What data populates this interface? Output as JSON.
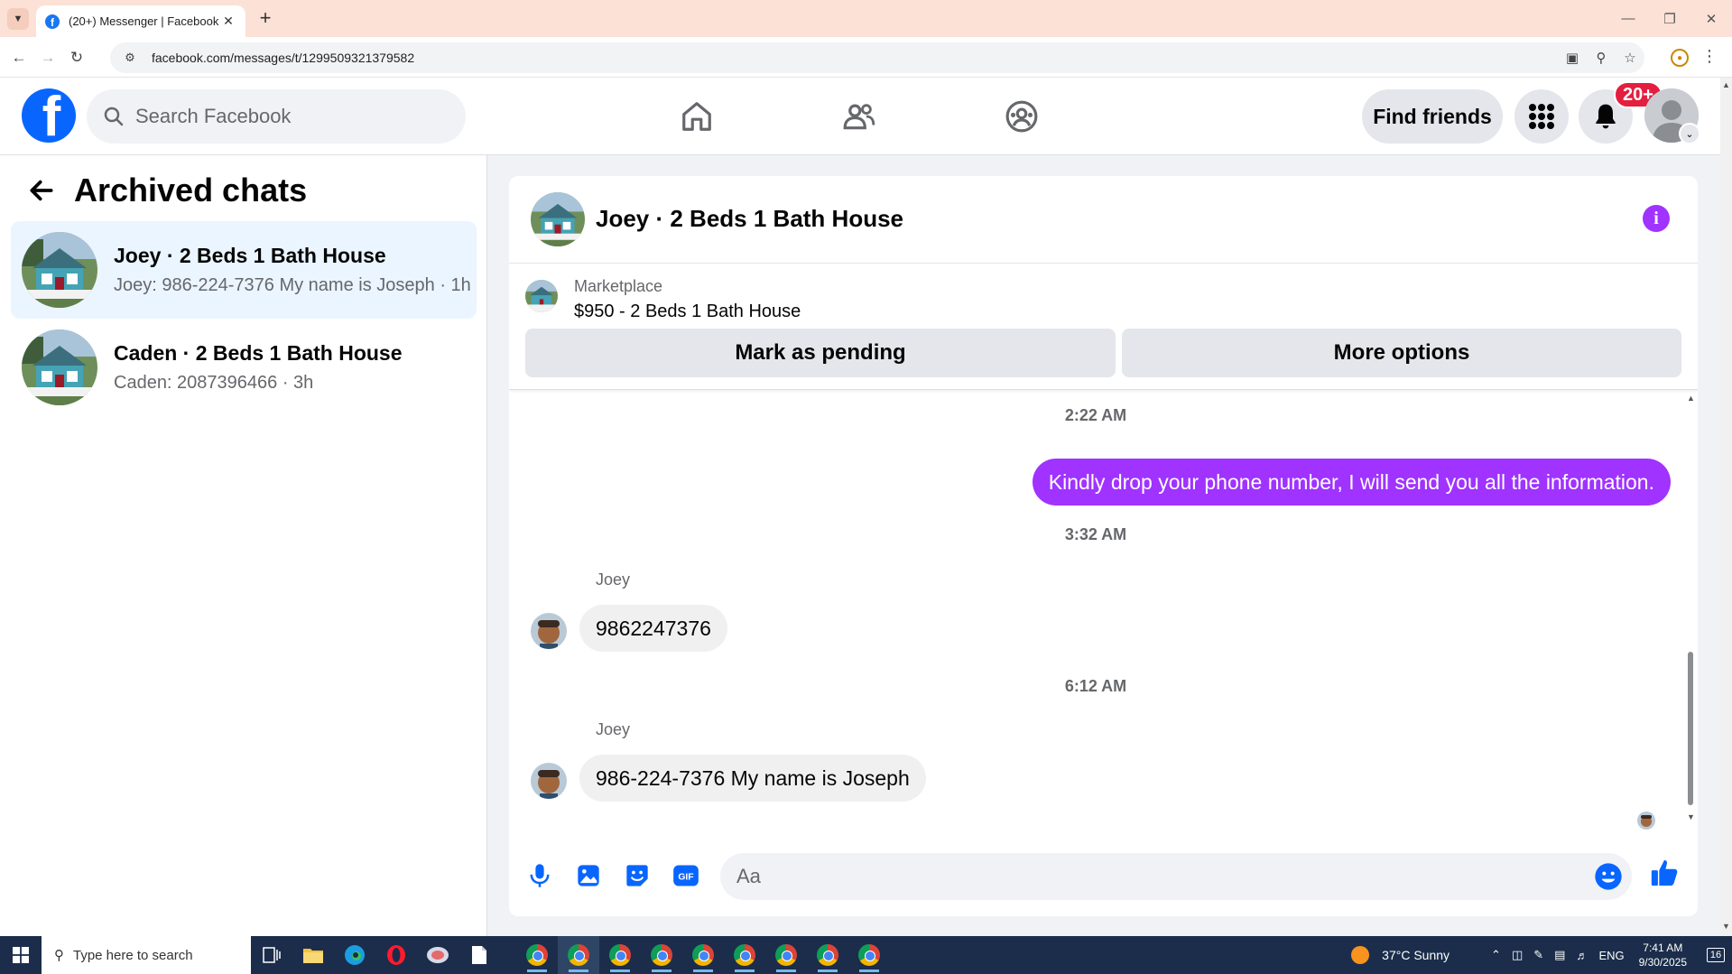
{
  "browser": {
    "tab_title": "(20+) Messenger | Facebook",
    "url": "facebook.com/messages/t/1299509321379582"
  },
  "header": {
    "search_placeholder": "Search Facebook",
    "find_friends_label": "Find friends",
    "notification_count": "20+"
  },
  "sidebar": {
    "title": "Archived chats",
    "chats": [
      {
        "name": "Joey · 2 Beds 1 Bath House",
        "preview": "Joey: 986-224-7376 My name is Joseph · 1h"
      },
      {
        "name": "Caden · 2 Beds 1 Bath House",
        "preview": "Caden: 2087396466 · 3h"
      }
    ]
  },
  "conversation": {
    "title": "Joey · 2 Beds 1 Bath House",
    "marketplace_label": "Marketplace",
    "listing": "$950 - 2 Beds 1 Bath House",
    "mark_pending_label": "Mark as pending",
    "more_options_label": "More options",
    "messages": [
      {
        "time": "2:22 AM",
        "text": "Kindly drop your phone number, I will send you all the information."
      },
      {
        "time": "3:32 AM",
        "sender": "Joey",
        "text": "9862247376"
      },
      {
        "time": "6:12 AM",
        "sender": "Joey",
        "text": "986-224-7376 My name is Joseph"
      }
    ],
    "composer_placeholder": "Aa"
  },
  "taskbar": {
    "search_placeholder": "Type here to search",
    "weather": "37°C  Sunny",
    "language": "ENG",
    "time": "7:41 AM",
    "date": "9/30/2025",
    "notifications": "16"
  },
  "colors": {
    "facebook_blue": "#0866ff",
    "messenger_purple": "#a033ff",
    "active_chat_bg": "#ebf5ff",
    "badge_red": "#e41e3f"
  }
}
